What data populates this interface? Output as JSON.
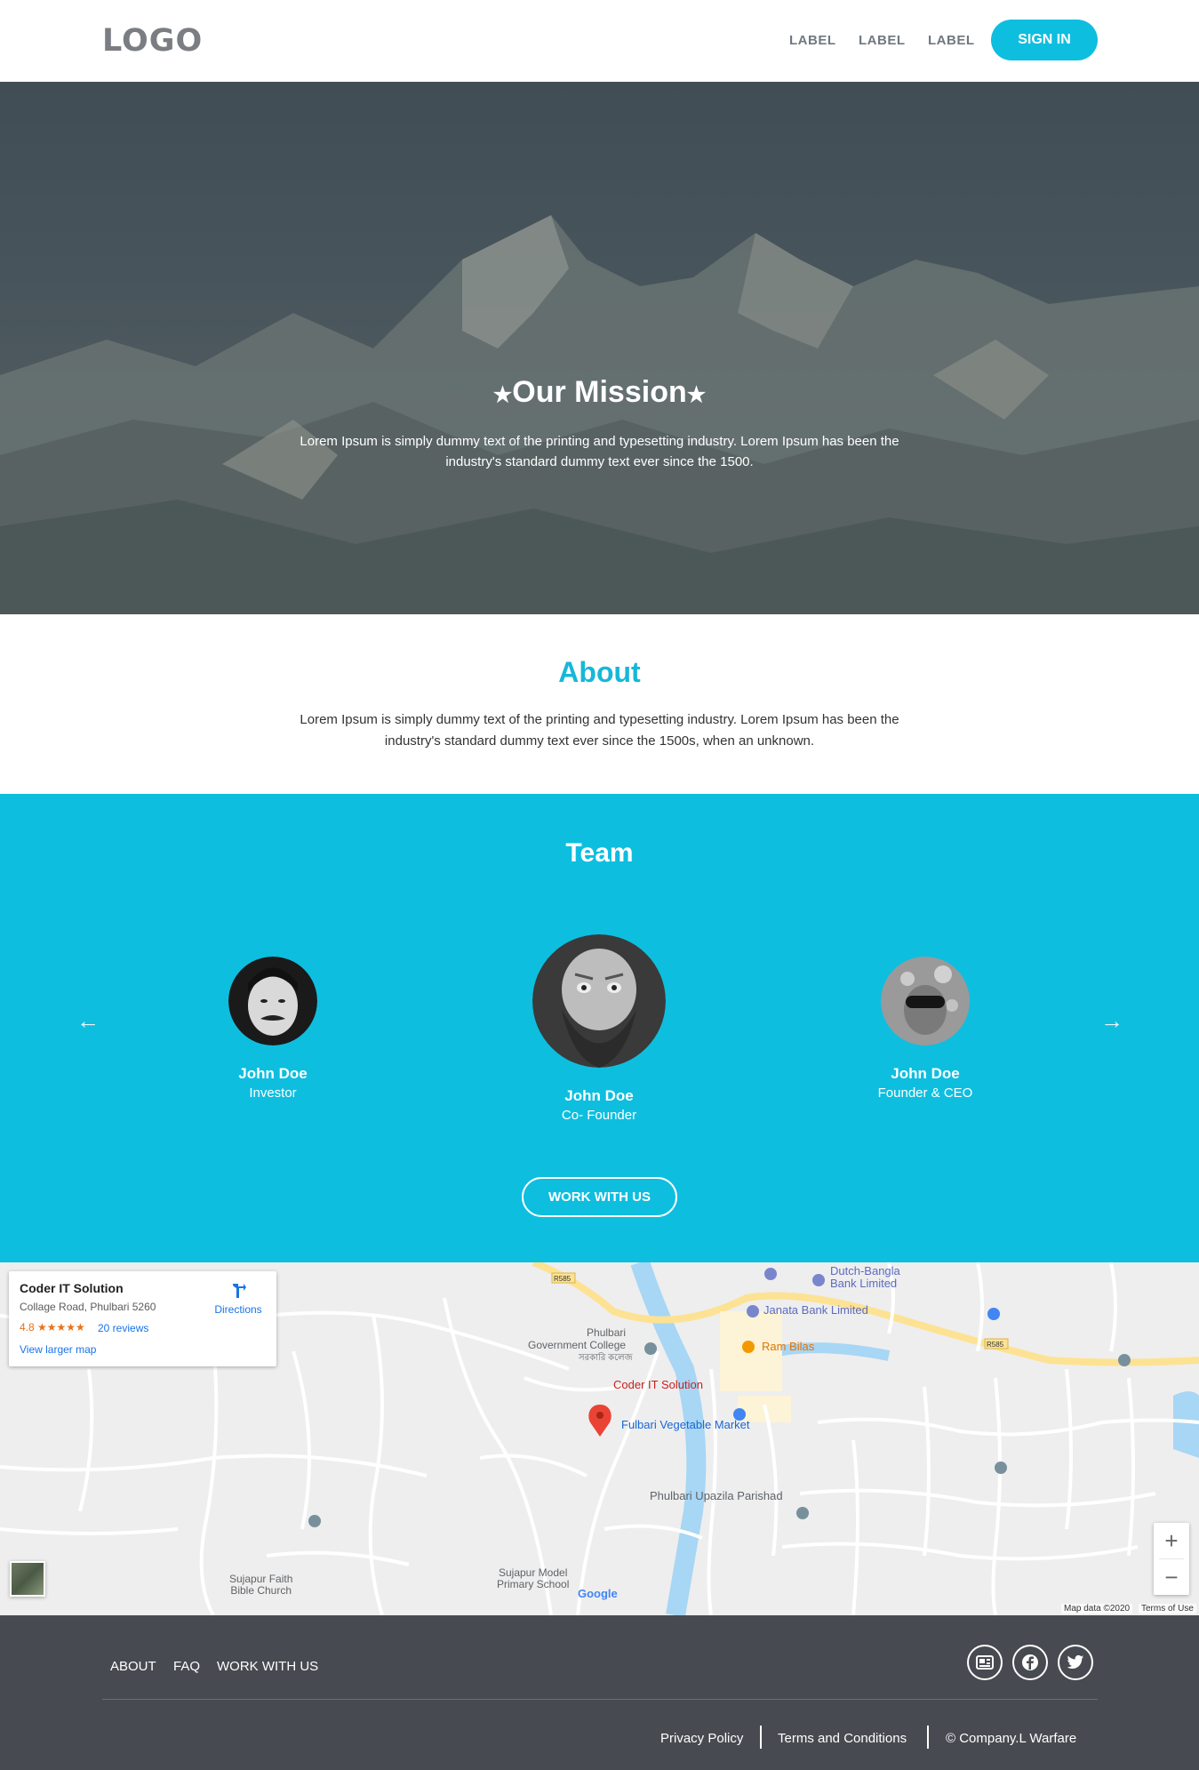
{
  "header": {
    "logo": "LOGO",
    "nav": [
      "LABEL",
      "LABEL",
      "LABEL"
    ],
    "signin": "SIGN IN"
  },
  "hero": {
    "title": "Our Mission",
    "text": "Lorem Ipsum is simply dummy text of the printing and typesetting industry. Lorem Ipsum has been the industry's standard dummy text ever since the 1500."
  },
  "about": {
    "title": "About",
    "text": "Lorem Ipsum is simply dummy text of the printing and typesetting industry. Lorem Ipsum has been the industry's standard dummy text ever since the 1500s, when an unknown."
  },
  "team": {
    "title": "Team",
    "prev": "←",
    "next": "→",
    "members": [
      {
        "name": "John Doe",
        "role": "Investor"
      },
      {
        "name": "John Doe",
        "role": "Co- Founder"
      },
      {
        "name": "John Doe",
        "role": "Founder & CEO"
      }
    ],
    "cta": "WORK WITH US"
  },
  "map": {
    "card": {
      "name": "Coder IT Solution",
      "address": "Collage Road, Phulbari 5260",
      "rating": "4.8 ★★★★★",
      "reviews": "20 reviews",
      "larger": "View larger map",
      "directions": "Directions"
    },
    "labels": {
      "pin": "Coder IT Solution",
      "college": "Phulbari\nGovernment College",
      "college_bn": "সরকারি কলেজ",
      "dutch_bangla": "Dutch-Bangla\nBank Limited",
      "janata": "Janata Bank Limited",
      "ram_bilas": "Ram Bilas",
      "vegetable": "Fulbari Vegetable Market",
      "upazila": "Phulbari Upazila Parishad",
      "school": "Sujapur Model\nPrimary School",
      "church": "Sujapur Faith\nBible Church",
      "road1": "R585",
      "road2": "R585",
      "google": "Google"
    },
    "map_data": "Map data ©2020",
    "terms": "Terms of Use",
    "zoom_in": "+",
    "zoom_out": "−"
  },
  "footer": {
    "links": [
      "ABOUT",
      "FAQ",
      "WORK WITH US"
    ],
    "social": [
      "news-icon",
      "facebook-icon",
      "twitter-icon"
    ],
    "privacy": "Privacy Policy",
    "terms": "Terms and Conditions",
    "copyright": "© Company.L Warfare"
  },
  "colors": {
    "accent": "#0ebedf",
    "footer": "#474a50",
    "about_title": "#17b7d9"
  }
}
